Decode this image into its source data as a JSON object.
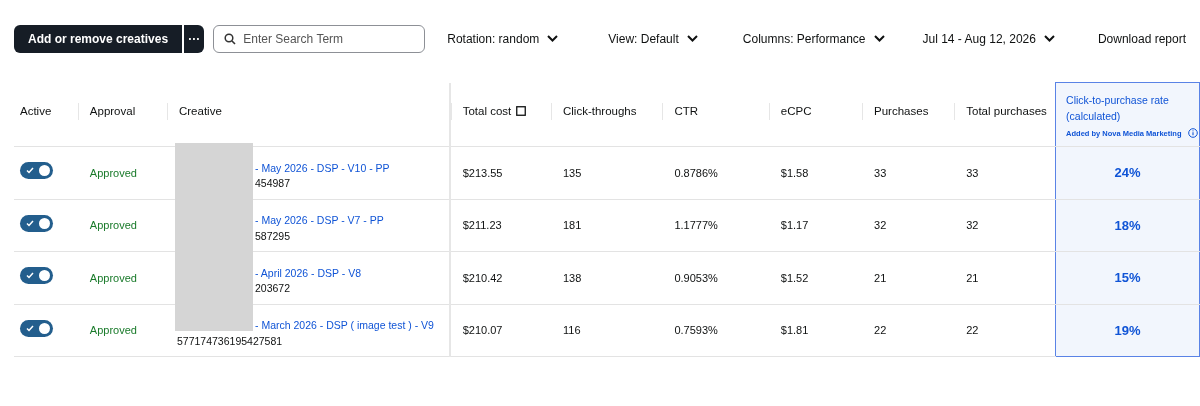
{
  "toolbar": {
    "primary_button": "Add or remove creatives",
    "more_button": "···",
    "search": {
      "placeholder": "Enter Search Term"
    },
    "dropdowns": [
      "Rotation: random",
      "View: Default",
      "Columns: Performance",
      "Jul 14 - Aug 12, 2026"
    ],
    "download_link": "Download report"
  },
  "table": {
    "columns": [
      "Active",
      "Approval",
      "Creative",
      "Total cost",
      "Click-throughs",
      "CTR",
      "eCPC",
      "Purchases",
      "Total purchases"
    ],
    "highlighted_column": {
      "title": "Click-to-purchase rate (calculated)",
      "note": "Added by Nova Media Marketing"
    },
    "rows": [
      {
        "active": true,
        "approval": "Approved",
        "creative_name": "- May 2026 - DSP - V10 - PP",
        "creative_id": "454987",
        "id_covered": true,
        "total_cost": "$213.55",
        "click_throughs": "135",
        "ctr": "0.8786%",
        "ecpc": "$1.58",
        "purchases": "33",
        "total_purchases": "33",
        "rate": "24%"
      },
      {
        "active": true,
        "approval": "Approved",
        "creative_name": "- May 2026 - DSP - V7 - PP",
        "creative_id": "587295",
        "id_covered": true,
        "total_cost": "$211.23",
        "click_throughs": "181",
        "ctr": "1.1777%",
        "ecpc": "$1.17",
        "purchases": "32",
        "total_purchases": "32",
        "rate": "18%"
      },
      {
        "active": true,
        "approval": "Approved",
        "creative_name": "- April 2026 - DSP - V8",
        "creative_id": "203672",
        "id_covered": true,
        "total_cost": "$210.42",
        "click_throughs": "138",
        "ctr": "0.9053%",
        "ecpc": "$1.52",
        "purchases": "21",
        "total_purchases": "21",
        "rate": "15%"
      },
      {
        "active": true,
        "approval": "Approved",
        "creative_name": "- March 2026 - DSP ( image test ) - V9",
        "creative_id": "577174736195427581",
        "id_covered": false,
        "total_cost": "$210.07",
        "click_throughs": "116",
        "ctr": "0.7593%",
        "ecpc": "$1.81",
        "purchases": "22",
        "total_purchases": "22",
        "rate": "19%"
      }
    ]
  }
}
